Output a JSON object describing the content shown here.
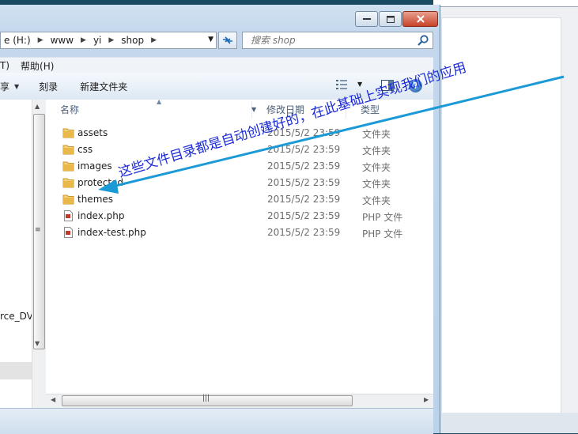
{
  "window": {
    "caption_buttons": [
      "minimize",
      "maximize",
      "close"
    ]
  },
  "address_bar": {
    "crumbs": [
      "e (H:)",
      "www",
      "yi",
      "shop"
    ],
    "dropdown_icon": "chevron-down-icon",
    "refresh_icon": "refresh-icon"
  },
  "search": {
    "placeholder": "搜索 shop",
    "icon": "search-icon"
  },
  "menu": {
    "items": [
      "T)",
      "帮助(H)"
    ]
  },
  "toolbar": {
    "share_label": "享",
    "burn_label": "刻录",
    "new_folder_label": "新建文件夹",
    "view_icon": "view-list-icon",
    "preview_icon": "preview-pane-icon",
    "help_icon": "help-icon",
    "help_glyph": "?"
  },
  "nav_pane": {
    "visible_label": "rce_DV"
  },
  "columns": {
    "name": "名称",
    "date": "修改日期",
    "type": "类型"
  },
  "files": [
    {
      "name": "assets",
      "date": "2015/5/2 23:59",
      "type": "文件夹",
      "kind": "folder"
    },
    {
      "name": "css",
      "date": "2015/5/2 23:59",
      "type": "文件夹",
      "kind": "folder"
    },
    {
      "name": "images",
      "date": "2015/5/2 23:59",
      "type": "文件夹",
      "kind": "folder"
    },
    {
      "name": "protected",
      "date": "2015/5/2 23:59",
      "type": "文件夹",
      "kind": "folder"
    },
    {
      "name": "themes",
      "date": "2015/5/2 23:59",
      "type": "文件夹",
      "kind": "folder"
    },
    {
      "name": "index.php",
      "date": "2015/5/2 23:59",
      "type": "PHP 文件",
      "kind": "php"
    },
    {
      "name": "index-test.php",
      "date": "2015/5/2 23:59",
      "type": "PHP 文件",
      "kind": "php"
    }
  ],
  "annotation": {
    "text": "这些文件目录都是自动创建好的，在此基础上实现我们的应用",
    "color": "#1a2ad6",
    "arrow_color": "#1b9ad6"
  },
  "colors": {
    "folder": "#e8b84a",
    "selection_blue": "#3399ff"
  }
}
